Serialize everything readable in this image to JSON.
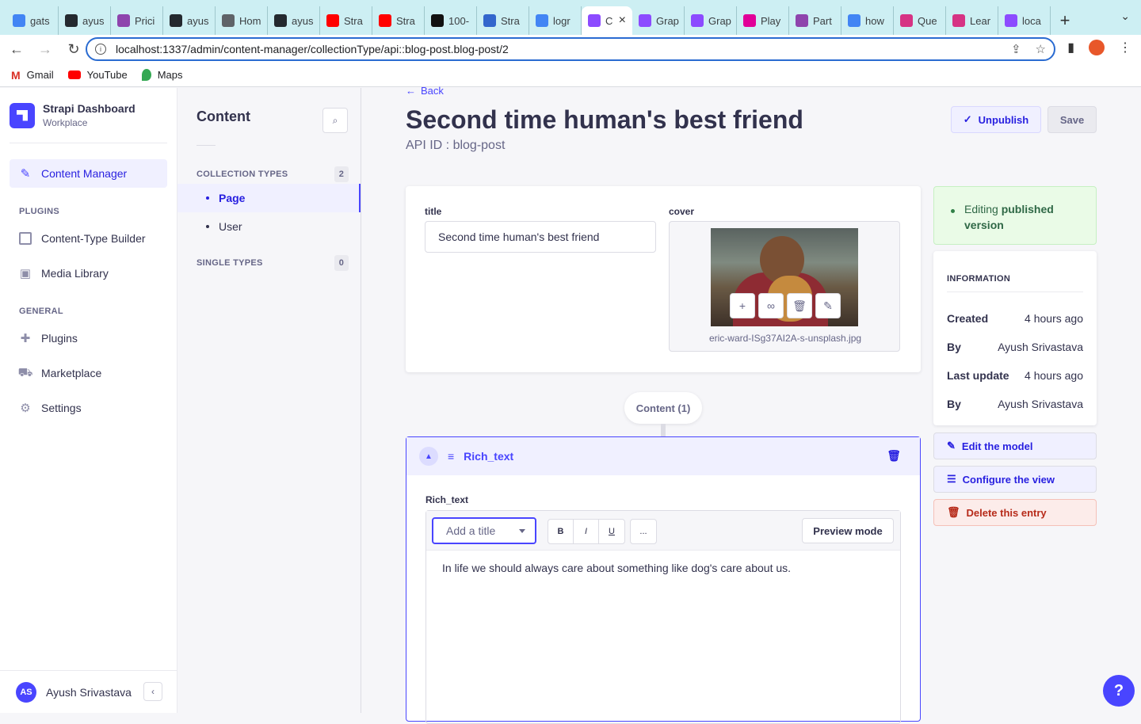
{
  "browser": {
    "tabs": [
      {
        "label": "gats",
        "icon": "google-icon",
        "color": "#4285f4"
      },
      {
        "label": "ayus",
        "icon": "github-icon",
        "color": "#24292f"
      },
      {
        "label": "Prici",
        "icon": "strapi-icon",
        "color": "#8e44ad"
      },
      {
        "label": "ayus",
        "icon": "github-icon",
        "color": "#24292f"
      },
      {
        "label": "Hom",
        "icon": "globe-icon",
        "color": "#5f6368"
      },
      {
        "label": "ayus",
        "icon": "github-icon",
        "color": "#24292f"
      },
      {
        "label": "Stra",
        "icon": "youtube-icon",
        "color": "#ff0000"
      },
      {
        "label": "Stra",
        "icon": "youtube-icon",
        "color": "#ff0000"
      },
      {
        "label": "100-",
        "icon": "site-icon",
        "color": "#111111"
      },
      {
        "label": "Stra",
        "icon": "site-icon",
        "color": "#3366cc"
      },
      {
        "label": "logr",
        "icon": "google-icon",
        "color": "#4285f4"
      },
      {
        "label": "C",
        "icon": "strapi-icon",
        "color": "#8c4bff",
        "active": true
      },
      {
        "label": "Grap",
        "icon": "strapi-icon",
        "color": "#8c4bff"
      },
      {
        "label": "Grap",
        "icon": "strapi-icon",
        "color": "#8c4bff"
      },
      {
        "label": "Play",
        "icon": "site-icon",
        "color": "#e10098"
      },
      {
        "label": "Part",
        "icon": "site-icon",
        "color": "#8e44ad"
      },
      {
        "label": "how",
        "icon": "google-icon",
        "color": "#4285f4"
      },
      {
        "label": "Que",
        "icon": "site-icon",
        "color": "#d63384"
      },
      {
        "label": "Lear",
        "icon": "site-icon",
        "color": "#d63384"
      },
      {
        "label": "loca",
        "icon": "strapi-icon",
        "color": "#8c4bff"
      }
    ],
    "url": "localhost:1337/admin/content-manager/collectionType/api::blog-post.blog-post/2",
    "bookmarks": [
      {
        "label": "Gmail",
        "icon": "gmail-icon"
      },
      {
        "label": "YouTube",
        "icon": "youtube-icon"
      },
      {
        "label": "Maps",
        "icon": "maps-icon"
      }
    ]
  },
  "mainnav": {
    "brand_title": "Strapi Dashboard",
    "brand_sub": "Workplace",
    "active_item": "Content Manager",
    "plugins_heading": "PLUGINS",
    "plugins": [
      "Content-Type Builder",
      "Media Library"
    ],
    "general_heading": "GENERAL",
    "general": [
      "Plugins",
      "Marketplace",
      "Settings"
    ],
    "user_initials": "AS",
    "user_name": "Ayush Srivastava"
  },
  "subnav": {
    "title": "Content",
    "collection_heading": "COLLECTION TYPES",
    "collection_count": "2",
    "collection_items": [
      "Page",
      "User"
    ],
    "single_heading": "SINGLE TYPES",
    "single_count": "0"
  },
  "header": {
    "back": "Back",
    "title": "Second time human's best friend",
    "api_id": "API ID : blog-post",
    "unpublish": "Unpublish",
    "save": "Save"
  },
  "form": {
    "title_label": "title",
    "title_value": "Second time human's best friend",
    "cover_label": "cover",
    "cover_filename": "eric-ward-ISg37AI2A-s-unsplash.jpg"
  },
  "aside": {
    "status_prefix": "Editing ",
    "status_bold": "published version",
    "info_heading": "INFORMATION",
    "rows": [
      {
        "label": "Created",
        "value": "4 hours ago"
      },
      {
        "label": "By",
        "value": "Ayush Srivastava"
      },
      {
        "label": "Last update",
        "value": "4 hours ago"
      },
      {
        "label": "By",
        "value": "Ayush Srivastava"
      }
    ],
    "edit_model": "Edit the model",
    "configure_view": "Configure the view",
    "delete_entry": "Delete this entry"
  },
  "dynamic_zone": {
    "pill": "Content (1)",
    "component_name": "Rich_text",
    "field_label": "Rich_text",
    "heading_placeholder": "Add a title",
    "bold": "B",
    "italic": "I",
    "underline": "U",
    "more": "...",
    "preview": "Preview mode",
    "text": "In life we should always care about something like dog's care about us."
  },
  "help": "?"
}
